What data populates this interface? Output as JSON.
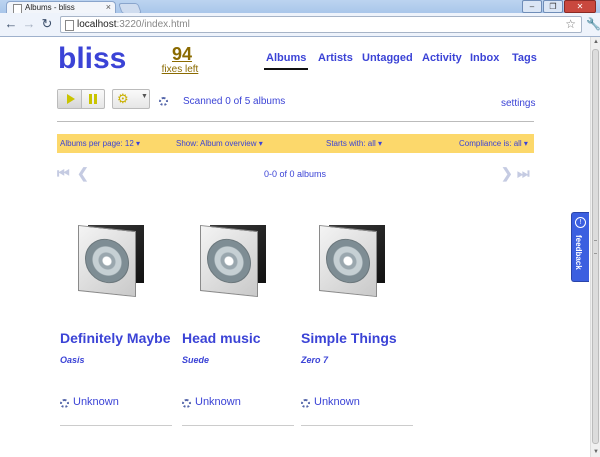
{
  "browser": {
    "tab_title": "Albums - bliss",
    "tab_close": "×",
    "url_host": "localhost",
    "url_rest": ":3220/index.html",
    "window_buttons": [
      "–",
      "❐",
      "✕"
    ]
  },
  "header": {
    "logo": "bliss",
    "fixes_count": "94",
    "fixes_label": "fixes left",
    "nav": [
      "Albums",
      "Artists",
      "Untagged",
      "Activity",
      "Inbox",
      "Tags"
    ],
    "active_nav": "Albums"
  },
  "controls": {
    "scan_status": "Scanned 0 of 5 albums",
    "settings_link": "settings"
  },
  "filters": {
    "per_page": "Albums per page: 12 ▾",
    "show": "Show: Album overview ▾",
    "starts_with": "Starts with: all ▾",
    "compliance": "Compliance is: all ▾"
  },
  "pager": {
    "text": "0-0 of 0 albums",
    "first": "⏮",
    "prev": "❮",
    "next": "❯",
    "last": "⏭"
  },
  "albums": [
    {
      "title": "Definitely Maybe",
      "artist": "Oasis",
      "status": "Unknown"
    },
    {
      "title": "Head music",
      "artist": "Suede",
      "status": "Unknown"
    },
    {
      "title": "Simple Things",
      "artist": "Zero 7",
      "status": "Unknown"
    }
  ],
  "feedback": {
    "label": "feedback"
  },
  "colors": {
    "accent": "#3b43d6",
    "filterbar": "#fcd86b",
    "fixes": "#8a6a00",
    "feedback_tab": "#3b5fe0"
  }
}
